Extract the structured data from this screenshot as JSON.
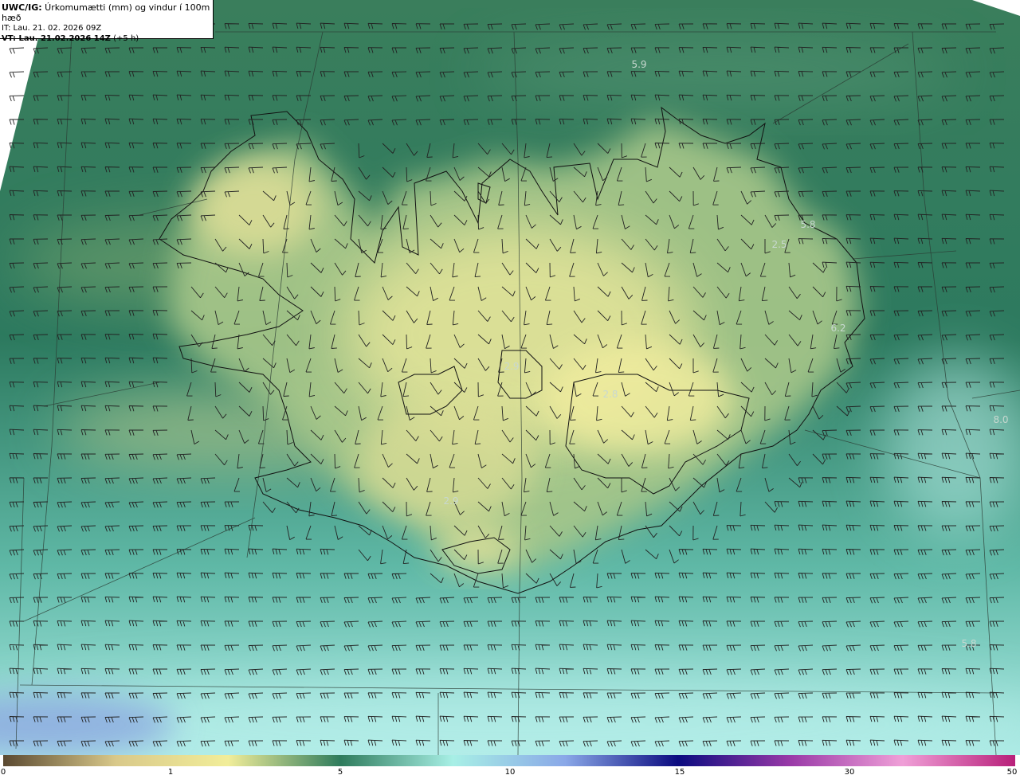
{
  "header": {
    "model": "UWC/IG:",
    "product": " Úrkomumætti (mm) og vindur í 100m hæð",
    "it_label": "IT:",
    "it_value": " Lau. 21. 02. 2026 09Z",
    "vt_label": "VT: Lau. 21.02.2026 14Z",
    "vt_offset": " (+5 h)"
  },
  "colorbar": {
    "ticks": [
      "0",
      "1",
      "5",
      "10",
      "15",
      "30",
      "50"
    ],
    "colors": [
      "#5b4a32",
      "#d9c98a",
      "#f2ee9a",
      "#2f7c5d",
      "#a8f0e6",
      "#8aa8e8",
      "#0b0b80",
      "#9a3aa8",
      "#f0a0d8",
      "#b8207a"
    ]
  },
  "map_labels": [
    "5.9",
    "5.8",
    "2.5",
    "6.2",
    "8.0",
    "2.9",
    "5.8",
    "2.9",
    "2.8"
  ],
  "colors": {
    "land_high": "#e9e79a",
    "sea": "#2f7f62",
    "coast": "#111111"
  }
}
